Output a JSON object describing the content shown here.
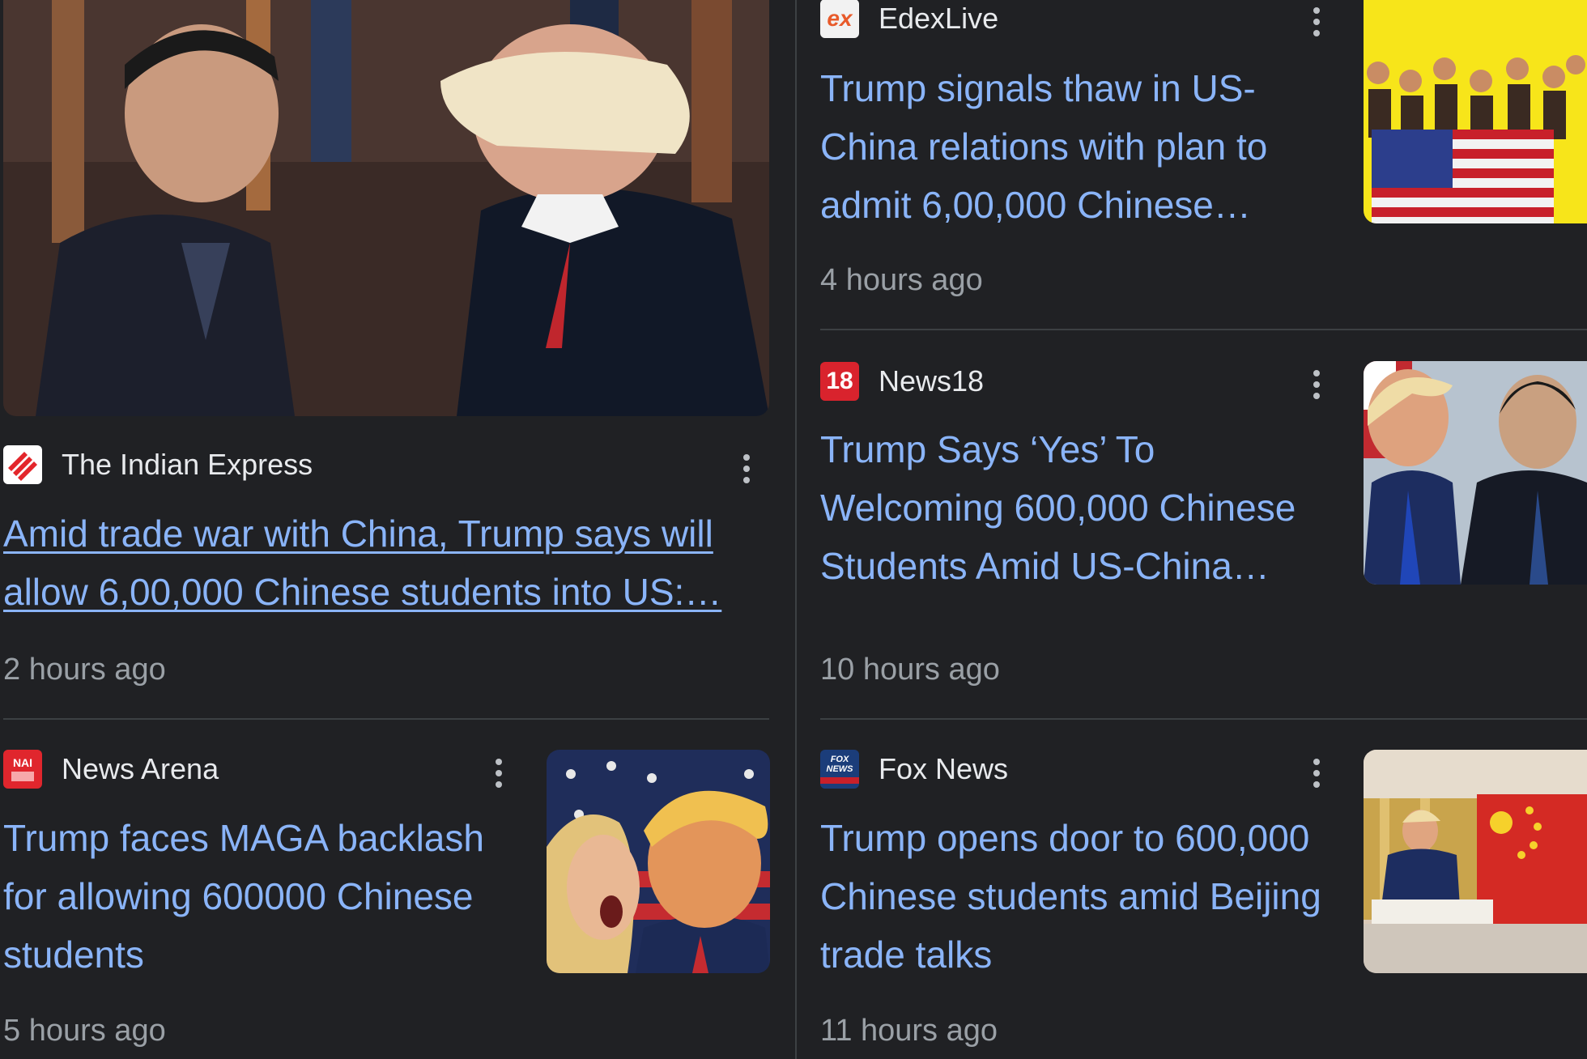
{
  "colors": {
    "background": "#202124",
    "link": "#8ab4f8",
    "meta": "#9aa0a6",
    "divider": "#3c4043"
  },
  "articles": [
    {
      "source": "The Indian Express",
      "source_logo": "indian-express-logo",
      "headline": "Amid trade war with China, Trump says will allow 6,00,000 Chinese students into US:…",
      "time": "2 hours ago",
      "image": "xi-trump-handshake-photo"
    },
    {
      "source": "EdexLive",
      "source_logo": "edexlive-logo",
      "logo_text": "ex",
      "headline": "Trump signals thaw in US-China relations with plan to admit 6,00,000 Chinese…",
      "time": "4 hours ago",
      "image": "students-with-us-flag-photo"
    },
    {
      "source": "News18",
      "source_logo": "news18-logo",
      "logo_text": "18",
      "headline": "Trump Says ‘Yes’ To Welcoming 600,000 Chinese Students Amid US-China…",
      "time": "10 hours ago",
      "image": "trump-xi-meeting-photo"
    },
    {
      "source": "News Arena",
      "source_logo": "news-arena-logo",
      "logo_text": "NAI",
      "headline": "Trump faces MAGA backlash for allowing 600000 Chinese students",
      "time": "5 hours ago",
      "image": "trump-protester-illustration"
    },
    {
      "source": "Fox News",
      "source_logo": "fox-news-logo",
      "logo_text": "FOX NEWS",
      "headline": "Trump opens door to 600,000 Chinese students amid Beijing trade talks",
      "time": "11 hours ago",
      "image": "trump-signing-china-flag-photo"
    }
  ]
}
